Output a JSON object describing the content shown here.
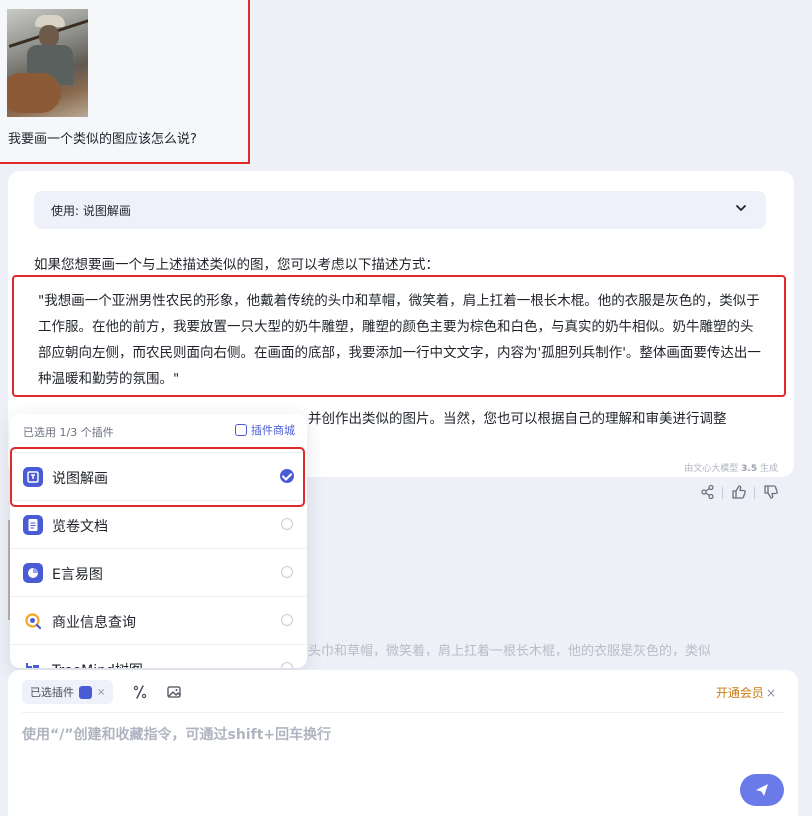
{
  "user_message": {
    "text": "我要画一个类似的图应该怎么说?"
  },
  "answer": {
    "tool_label": "使用: 说图解画",
    "intro": "如果您想要画一个与上述描述类似的图，您可以考虑以下描述方式：",
    "quote": "\"我想画一个亚洲男性农民的形象，他戴着传统的头巾和草帽，微笑着，肩上扛着一根长木棍。他的衣服是灰色的，类似于工作服。在他的前方，我要放置一只大型的奶牛雕塑，雕塑的颜色主要为棕色和白色，与真实的奶牛相似。奶牛雕塑的头部应朝向左侧，而农民则面向右侧。在画面的底部，我要添加一行中文文字，内容为'孤胆列兵制作'。整体画面要传达出一种温暖和勤劳的氛围。\"",
    "continuation": "并创作出类似的图片。当然，您也可以根据自己的理解和审美进行调整",
    "generated_by_prefix": "由文心大模型",
    "generated_by_model": "3.5",
    "generated_by_suffix": "生成"
  },
  "background_snippet": "的头巾和草帽，微笑着，肩上扛着一根长木棍，他的衣服是灰色的，类似",
  "plugin_panel": {
    "header": "已选用 1/3 个插件",
    "store_label": "插件商城",
    "items": [
      {
        "name": "说图解画",
        "selected": true,
        "icon": "picture-icon",
        "color": "#4a5bd6"
      },
      {
        "name": "览卷文档",
        "selected": false,
        "icon": "document-icon",
        "color": "#4a5bd6"
      },
      {
        "name": "E言易图",
        "selected": false,
        "icon": "pie-chart-icon",
        "color": "#4a5bd6"
      },
      {
        "name": "商业信息查询",
        "selected": false,
        "icon": "search-icon",
        "color": "#f5a623"
      },
      {
        "name": "TreeMind树图",
        "selected": false,
        "icon": "tree-icon",
        "color": "#4a5bd6"
      }
    ]
  },
  "input": {
    "chip_label": "已选插件",
    "placeholder": "使用“/”创建和收藏指令，可通过shift+回车换行",
    "vip_label": "开通会员",
    "vip_close": "×"
  },
  "colors": {
    "accent": "#4a5bd6",
    "highlight_border": "#e02a2a",
    "vip": "#c97a14"
  }
}
